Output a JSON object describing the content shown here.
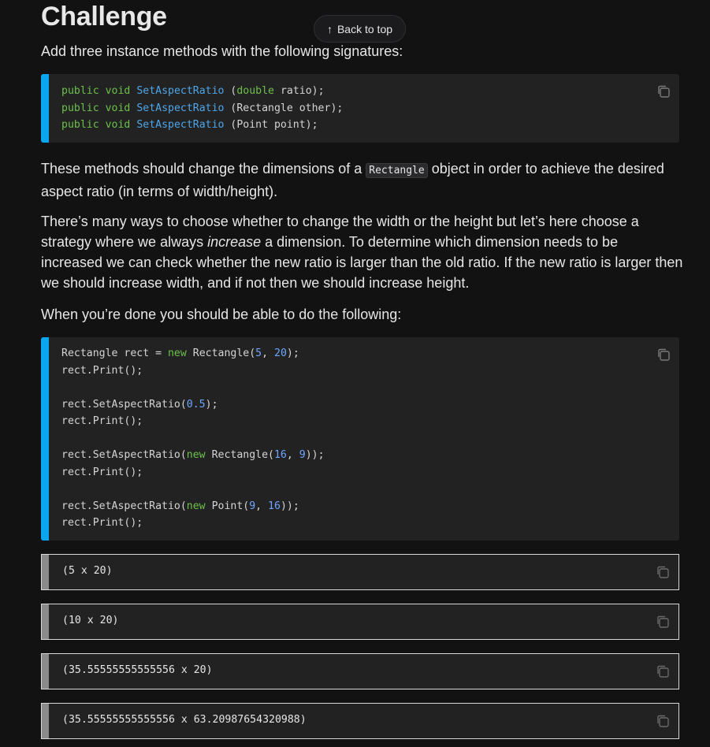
{
  "heading": "Challenge",
  "back_to_top": {
    "label": "Back to top",
    "icon": "arrow-up-icon"
  },
  "intro": "Add three instance methods with the following signatures:",
  "signatures": [
    {
      "mod": "public",
      "type": "void",
      "name": "SetAspectRatio",
      "params_kw": "double",
      "params_rest": " ratio);",
      "open": " ("
    },
    {
      "mod": "public",
      "type": "void",
      "name": "SetAspectRatio",
      "params_kw": "",
      "params_rest": "Rectangle other);",
      "open": " ("
    },
    {
      "mod": "public",
      "type": "void",
      "name": "SetAspectRatio",
      "params_kw": "",
      "params_rest": "Point point);",
      "open": " ("
    }
  ],
  "para1": {
    "before": "These methods should change the dimensions of a ",
    "code": "Rectangle",
    "after": " object in order to achieve the desired aspect ratio (in terms of width/height)."
  },
  "para2": {
    "before": "There’s many ways to choose whether to change the width or the height but let’s here choose a strategy where we always ",
    "em": "increase",
    "after": " a dimension. To determine which dimension needs to be increased we can check whether the new ratio is larger than the old ratio. If the new ratio is larger then we should increase width, and if not then we should increase height."
  },
  "para3": "When you’re done you should be able to do the following:",
  "example_code_lines": [
    "Rectangle rect = new Rectangle(5, 20);",
    "rect.Print();",
    "",
    "rect.SetAspectRatio(0.5);",
    "rect.Print();",
    "",
    "rect.SetAspectRatio(new Rectangle(16, 9));",
    "rect.Print();",
    "",
    "rect.SetAspectRatio(new Point(9, 16));",
    "rect.Print();"
  ],
  "outputs": [
    "(5 x 20)",
    "(10 x 20)",
    "(35.55555555555556 x 20)",
    "(35.55555555555556 x 63.20987654320988)"
  ],
  "colors": {
    "background": "#121213",
    "code_accent": "#0aa7f0",
    "output_accent": "#8a8a8a",
    "keyword": "#6cc04a",
    "function": "#4fa6e8",
    "number": "#6ea6ff"
  },
  "copy_icon": "copy-icon"
}
